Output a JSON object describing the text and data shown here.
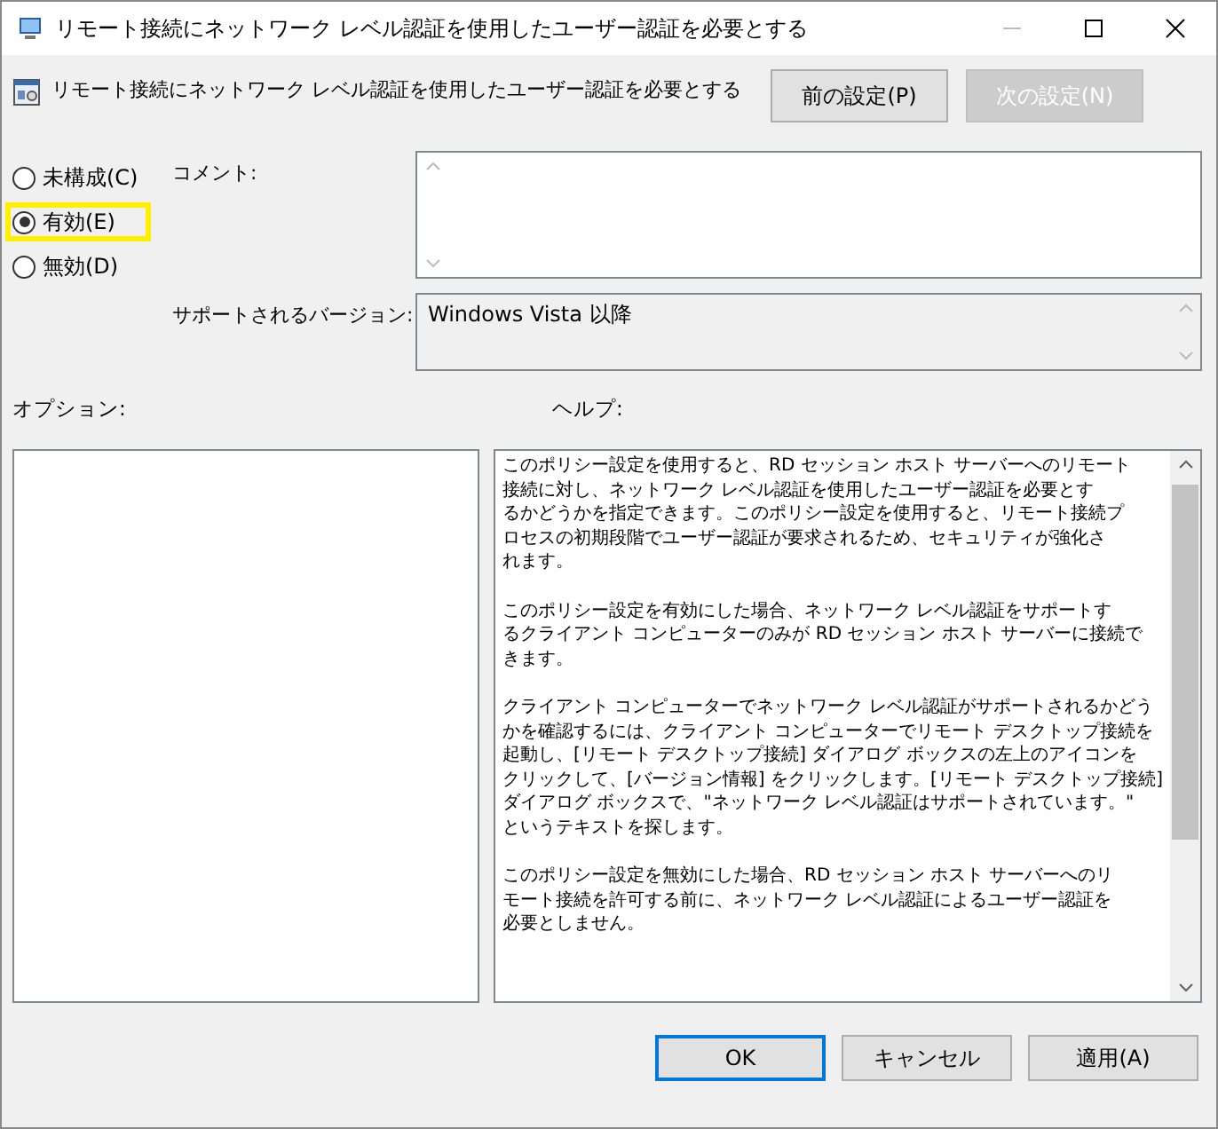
{
  "window": {
    "title": "リモート接続にネットワーク レベル認証を使用したユーザー認証を必要とする"
  },
  "header": {
    "policy_name": "リモート接続にネットワーク レベル認証を使用したユーザー認証を必要とする",
    "buttons": [
      {
        "label": "前の設定(P)",
        "disabled": false
      },
      {
        "label": "次の設定(N)",
        "disabled": true
      }
    ]
  },
  "state_options": [
    {
      "label": "未構成(C)",
      "selected": false,
      "highlighted": false
    },
    {
      "label": "有効(E)",
      "selected": true,
      "highlighted": true
    },
    {
      "label": "無効(D)",
      "selected": false,
      "highlighted": false
    }
  ],
  "comment": {
    "label": "コメント:"
  },
  "supported": {
    "label": "サポートされるバージョン:",
    "value": "Windows Vista 以降"
  },
  "options": {
    "label": "オプション:"
  },
  "help": {
    "label": "ヘルプ:",
    "paragraphs": [
      [
        "このポリシー設定を使用すると、RD セッション ホスト サーバーへのリモート",
        "接続に対し、ネットワーク レベル認証を使用したユーザー認証を必要とす",
        "るかどうかを指定できます。このポリシー設定を使用すると、リモート接続プ",
        "ロセスの初期段階でユーザー認証が要求されるため、セキュリティが強化さ",
        "れます。"
      ],
      [
        "このポリシー設定を有効にした場合、ネットワーク レベル認証をサポートす",
        "るクライアント コンピューターのみが RD セッション ホスト サーバーに接続で",
        "きます。"
      ],
      [
        "クライアント コンピューターでネットワーク レベル認証がサポートされるかどう",
        "かを確認するには、クライアント コンピューターでリモート デスクトップ接続を",
        "起動し、[リモート デスクトップ接続] ダイアログ ボックスの左上のアイコンを",
        "クリックして、[バージョン情報] をクリックします。[リモート デスクトップ接続]",
        "ダイアログ ボックスで、\"ネットワーク レベル認証はサポートされています。\"",
        "というテキストを探します。"
      ],
      [
        "このポリシー設定を無効にした場合、RD セッション ホスト サーバーへのリ",
        "モート接続を許可する前に、ネットワーク レベル認証によるユーザー認証を",
        "必要としません。"
      ]
    ]
  },
  "footer_buttons": [
    {
      "label": "OK",
      "kind": "default"
    },
    {
      "label": "キャンセル",
      "kind": "normal"
    },
    {
      "label": "適用(A)",
      "kind": "normal"
    }
  ]
}
